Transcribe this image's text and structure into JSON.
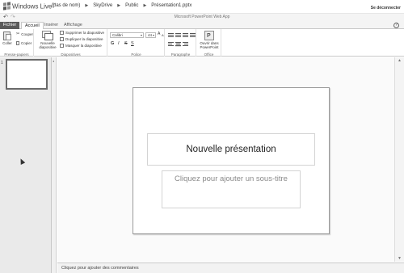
{
  "header": {
    "logo_text": "Windows Live",
    "logo_sup": "™",
    "breadcrumb": [
      "(pas de nom)",
      "SkyDrive",
      "Public",
      "Présentation1.pptx"
    ],
    "sign_out": "Se déconnecter"
  },
  "quickbar": {
    "app_title": "Microsoft PowerPoint Web App",
    "undo_icon": "undo-icon",
    "redo_icon": "redo-icon"
  },
  "tabs": [
    {
      "label": "Fichier",
      "active": false
    },
    {
      "label": "Accueil",
      "active": true
    },
    {
      "label": "Insérer",
      "active": false
    },
    {
      "label": "Affichage",
      "active": false
    }
  ],
  "ribbon": {
    "clipboard": {
      "paste": "Coller",
      "cut": "Couper",
      "copy": "Copier",
      "label": "Presse-papiers"
    },
    "slides": {
      "new_slide_line1": "Nouvelle",
      "new_slide_line2": "diapositive",
      "delete": "Supprimer la diapositive",
      "duplicate": "Dupliquer la diapositive",
      "hide": "Masquer la diapositive",
      "label": "Diapositives"
    },
    "font": {
      "font_name": "Calibri",
      "font_size": "44",
      "bold": "G",
      "italic": "I",
      "strike": "S",
      "underline": "S",
      "label": "Police"
    },
    "paragraph": {
      "label": "Paragraphe"
    },
    "office": {
      "open_line1": "Ouvrir dans",
      "open_line2": "PowerPoint",
      "label": "Office"
    }
  },
  "thumbnails": [
    {
      "number": "1"
    }
  ],
  "slide": {
    "title": "Nouvelle présentation",
    "subtitle": "Cliquez pour ajouter un sous-titre"
  },
  "notes": {
    "placeholder": "Cliquez pour ajouter des commentaires"
  }
}
